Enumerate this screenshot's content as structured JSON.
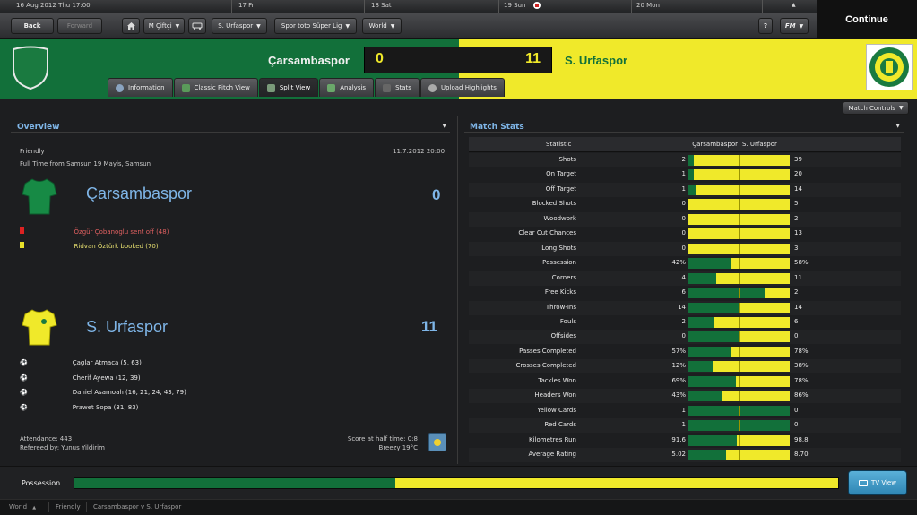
{
  "datebar": {
    "current": "16 Aug 2012 Thu 17:00",
    "days": [
      {
        "day": "17",
        "dow": "Fri"
      },
      {
        "day": "18",
        "dow": "Sat"
      },
      {
        "day": "19",
        "dow": "Sun"
      },
      {
        "day": "20",
        "dow": "Mon"
      }
    ],
    "arrow_up": "▲",
    "arrow_down": "▼"
  },
  "nav": {
    "back": "Back",
    "forward": "Forward",
    "manager": "M Çiftçi",
    "team": "S. Urfaspor",
    "league": "Spor toto Süper Lig",
    "world": "World",
    "help": "?",
    "fm": "FM"
  },
  "continue_label": "Continue",
  "match": {
    "home": "Çarsambaspor",
    "away": "S. Urfaspor",
    "home_score": "0",
    "away_score": "11"
  },
  "tabs": [
    {
      "label": "Information"
    },
    {
      "label": "Classic Pitch View"
    },
    {
      "label": "Split View"
    },
    {
      "label": "Analysis"
    },
    {
      "label": "Stats"
    },
    {
      "label": "Upload Highlights"
    }
  ],
  "match_controls": "Match Controls",
  "overview": {
    "title": "Overview",
    "competition": "Friendly",
    "datetime": "11.7.2012 20:00",
    "result_line": "Full Time from Samsun 19 Mayis, Samsun",
    "home_name": "Çarsambaspor",
    "home_score": "0",
    "home_events": [
      {
        "text": "Özgür Çobanoglu sent off (48)",
        "card": "red",
        "color": "#e06060"
      },
      {
        "text": "Ridvan Öztürk booked (70)",
        "card": "yellow",
        "color": "#e8e070"
      }
    ],
    "away_name": "S. Urfaspor",
    "away_score": "11",
    "away_events": [
      {
        "text": "Çaglar Atmaca (5, 63)"
      },
      {
        "text": "Cherif Ayewa (12, 39)"
      },
      {
        "text": "Daniel Asamoah (16, 21, 24, 43, 79)"
      },
      {
        "text": "Prawet Sopa (31, 83)"
      }
    ],
    "attendance": "Attendance: 443",
    "referee": "Refereed by: Yunus Yildirim",
    "halftime": "Score at half time: 0:8",
    "weather": "Breezy 19°C"
  },
  "stats": {
    "title": "Match Stats",
    "header_statistic": "Statistic",
    "header_home": "Çarsambaspor",
    "header_away": "S. Urfaspor",
    "rows": [
      {
        "label": "Shots",
        "home": "2",
        "away": "39",
        "ratio": 0.05
      },
      {
        "label": "On Target",
        "home": "1",
        "away": "20",
        "ratio": 0.05
      },
      {
        "label": "Off Target",
        "home": "1",
        "away": "14",
        "ratio": 0.07
      },
      {
        "label": "Blocked Shots",
        "home": "0",
        "away": "5",
        "ratio": 0.0
      },
      {
        "label": "Woodwork",
        "home": "0",
        "away": "2",
        "ratio": 0.0
      },
      {
        "label": "Clear Cut Chances",
        "home": "0",
        "away": "13",
        "ratio": 0.0
      },
      {
        "label": "Long Shots",
        "home": "0",
        "away": "3",
        "ratio": 0.0
      },
      {
        "label": "Possession",
        "home": "42%",
        "away": "58%",
        "ratio": 0.42
      },
      {
        "label": "Corners",
        "home": "4",
        "away": "11",
        "ratio": 0.27
      },
      {
        "label": "Free Kicks",
        "home": "6",
        "away": "2",
        "ratio": 0.75
      },
      {
        "label": "Throw-Ins",
        "home": "14",
        "away": "14",
        "ratio": 0.5
      },
      {
        "label": "Fouls",
        "home": "2",
        "away": "6",
        "ratio": 0.25
      },
      {
        "label": "Offsides",
        "home": "0",
        "away": "0",
        "ratio": 0.5
      },
      {
        "label": "Passes Completed",
        "home": "57%",
        "away": "78%",
        "ratio": 0.42
      },
      {
        "label": "Crosses Completed",
        "home": "12%",
        "away": "38%",
        "ratio": 0.24
      },
      {
        "label": "Tackles Won",
        "home": "69%",
        "away": "78%",
        "ratio": 0.47
      },
      {
        "label": "Headers Won",
        "home": "43%",
        "away": "86%",
        "ratio": 0.33
      },
      {
        "label": "Yellow Cards",
        "home": "1",
        "away": "0",
        "ratio": 1.0
      },
      {
        "label": "Red Cards",
        "home": "1",
        "away": "0",
        "ratio": 1.0
      },
      {
        "label": "Kilometres Run",
        "home": "91.6",
        "away": "98.8",
        "ratio": 0.48
      },
      {
        "label": "Average Rating",
        "home": "5.02",
        "away": "8.70",
        "ratio": 0.37
      }
    ]
  },
  "bottom": {
    "possession_label": "Possession",
    "possession_home_fraction": 0.42,
    "tv_view": "TV View"
  },
  "statusbar": {
    "world": "World",
    "friendly": "Friendly",
    "match": "Carsambaspor v S. Urfaspor"
  },
  "colors": {
    "home": "#12703a",
    "away": "#f0e92a"
  }
}
